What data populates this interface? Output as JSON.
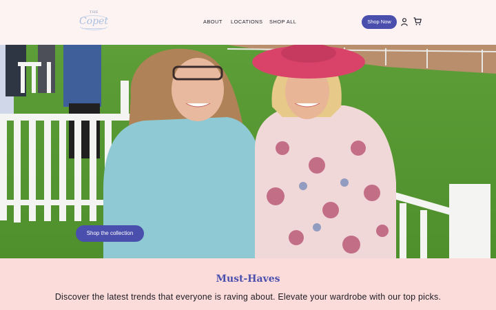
{
  "brand": {
    "logo_small": "THE",
    "logo_main": "Copet"
  },
  "nav": {
    "about": "ABOUT",
    "locations": "LOCATIONS",
    "shop_all": "SHOP ALL"
  },
  "header": {
    "shop_now": "Shop Now",
    "account_icon": "account-icon",
    "cart_icon": "cart-icon"
  },
  "hero": {
    "cta_label": "Shop the collection"
  },
  "section": {
    "title": "Must-Haves",
    "description": "Discover the latest trends that everyone is raving about. Elevate your wardrobe with our top picks."
  },
  "colors": {
    "accent": "#4a4fae",
    "header_bg": "#fdf3f2",
    "section_bg": "#fcdcdb"
  }
}
